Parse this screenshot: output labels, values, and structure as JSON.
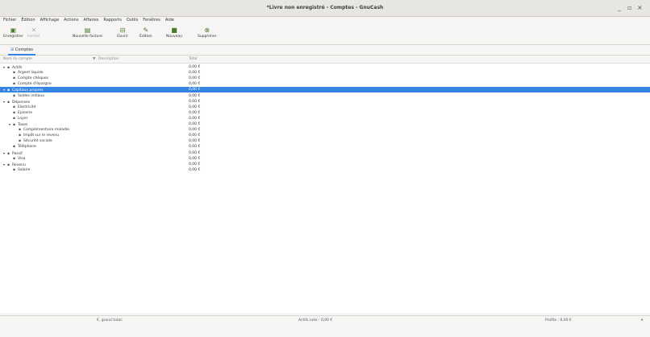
{
  "window": {
    "title": "*Livre non enregistré - Comptes - GnuCash",
    "controls": [
      "_",
      "▫",
      "×"
    ]
  },
  "menu": [
    "Fichier",
    "Édition",
    "Affichage",
    "Actions",
    "Affaires",
    "Rapports",
    "Outils",
    "Fenêtres",
    "Aide"
  ],
  "toolbar": [
    {
      "label": "Enregistrer",
      "icon": "save-icon",
      "glyph": "▣",
      "enabled": true
    },
    {
      "label": "Fermer",
      "icon": "close-icon",
      "glyph": "✕",
      "enabled": false
    },
    {
      "label": "Nouvelle facture",
      "icon": "invoice-icon",
      "glyph": "▤",
      "enabled": true
    },
    {
      "label": "Ouvrir",
      "icon": "open-icon",
      "glyph": "⊟",
      "enabled": true
    },
    {
      "label": "Édition",
      "icon": "edit-icon",
      "glyph": "✎",
      "enabled": true
    },
    {
      "label": "Nouveau",
      "icon": "new-icon",
      "glyph": "■",
      "enabled": true
    },
    {
      "label": "Supprimer",
      "icon": "delete-icon",
      "glyph": "⊗",
      "enabled": true
    }
  ],
  "tab": {
    "label": "Comptes",
    "icon": "accounts-icon"
  },
  "columns": {
    "name": "Nom du compte",
    "description": "Description",
    "total": "Total"
  },
  "accounts": [
    {
      "name": "Actifs",
      "level": 0,
      "expander": "▾",
      "total": "0,00 €"
    },
    {
      "name": "Argent liquide",
      "level": 1,
      "expander": "",
      "total": "0,00 €"
    },
    {
      "name": "Compte chèques",
      "level": 1,
      "expander": "",
      "total": "0,00 €"
    },
    {
      "name": "Compte d'épargne",
      "level": 1,
      "expander": "",
      "total": "0,00 €"
    },
    {
      "name": "Capitaux propres",
      "level": 0,
      "expander": "▾",
      "total": "0,00 €",
      "selected": true
    },
    {
      "name": "Soldes initiaux",
      "level": 1,
      "expander": "",
      "total": "0,00 €"
    },
    {
      "name": "Dépenses",
      "level": 0,
      "expander": "▾",
      "total": "0,00 €"
    },
    {
      "name": "Electricité",
      "level": 1,
      "expander": "",
      "total": "0,00 €"
    },
    {
      "name": "Epicerie",
      "level": 1,
      "expander": "",
      "total": "0,00 €"
    },
    {
      "name": "Loyer",
      "level": 1,
      "expander": "",
      "total": "0,00 €"
    },
    {
      "name": "Taxes",
      "level": 1,
      "expander": "▾",
      "total": "0,00 €"
    },
    {
      "name": "Complémentaire maladie",
      "level": 2,
      "expander": "",
      "total": "0,00 €"
    },
    {
      "name": "Impôt sur le revenu",
      "level": 2,
      "expander": "",
      "total": "0,00 €"
    },
    {
      "name": "Sécurité sociale",
      "level": 2,
      "expander": "",
      "total": "0,00 €"
    },
    {
      "name": "Téléphone",
      "level": 1,
      "expander": "",
      "total": "0,00 €"
    },
    {
      "name": "Passif",
      "level": 0,
      "expander": "▾",
      "total": "0,00 €"
    },
    {
      "name": "Visa",
      "level": 1,
      "expander": "",
      "total": "0,00 €"
    },
    {
      "name": "Revenu",
      "level": 0,
      "expander": "▾",
      "total": "0,00 €"
    },
    {
      "name": "Salaire",
      "level": 1,
      "expander": "",
      "total": "0,00 €"
    }
  ],
  "footer": {
    "grand_total": "€, grand total:",
    "net": "Actifs nets : 0,00 €",
    "profit": "Profits : 0,00 €",
    "arrow": "▾"
  },
  "lock_glyph": "🔒"
}
